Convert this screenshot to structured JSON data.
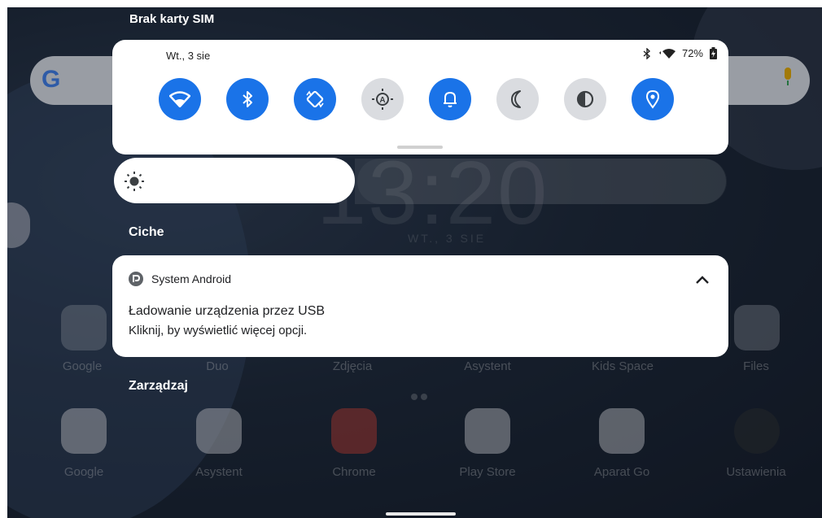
{
  "status_bar": {
    "carrier": "Brak karty SIM"
  },
  "quick_settings": {
    "date": "Wt., 3 sie",
    "battery": "72%",
    "tiles": [
      {
        "id": "wifi",
        "icon": "wifi-icon",
        "state": "on"
      },
      {
        "id": "bluetooth",
        "icon": "bluetooth-icon",
        "state": "on"
      },
      {
        "id": "auto-rotate",
        "icon": "rotate-icon",
        "state": "on"
      },
      {
        "id": "auto-brightness",
        "icon": "auto-brightness-icon",
        "state": "off"
      },
      {
        "id": "sound",
        "icon": "bell-icon",
        "state": "on"
      },
      {
        "id": "do-not-disturb",
        "icon": "moon-icon",
        "state": "off"
      },
      {
        "id": "dark-theme",
        "icon": "contrast-icon",
        "state": "off"
      },
      {
        "id": "location",
        "icon": "location-icon",
        "state": "on"
      }
    ],
    "colors": {
      "active": "#1a73e8",
      "inactive": "#dadce0"
    }
  },
  "brightness": {
    "icon": "sun-icon"
  },
  "notifications": {
    "section_label": "Ciche",
    "items": [
      {
        "app": "System Android",
        "title": "Ładowanie urządzenia przez USB",
        "text": "Kliknij, by wyświetlić więcej opcji."
      }
    ],
    "manage_label": "Zarządzaj"
  },
  "home": {
    "clock": "13:20",
    "date": "WT., 3 SIE",
    "row1": [
      "Google",
      "Duo",
      "Zdjęcia",
      "Asystent",
      "Kids Space",
      "Files"
    ],
    "row2": [
      "Google",
      "Asystent",
      "Chrome",
      "Play Store",
      "Aparat Go",
      "Ustawienia"
    ]
  }
}
